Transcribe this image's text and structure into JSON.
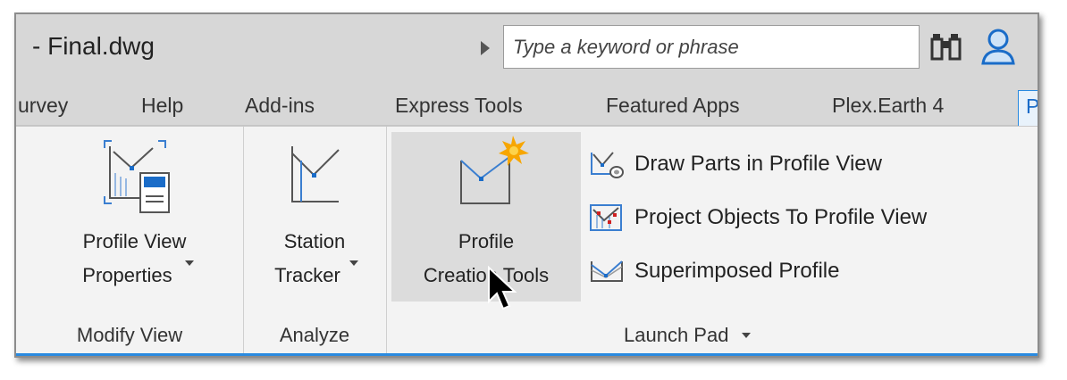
{
  "titlebar": {
    "doc_title": "- Final.dwg",
    "search_placeholder": "Type a keyword or phrase"
  },
  "tabs": [
    {
      "label": "urvey"
    },
    {
      "label": "Help"
    },
    {
      "label": "Add-ins"
    },
    {
      "label": "Express Tools"
    },
    {
      "label": "Featured Apps"
    },
    {
      "label": "Plex.Earth 4"
    },
    {
      "label": "P"
    }
  ],
  "ribbon": {
    "modify_view": {
      "title": "Modify View",
      "button_line1": "Profile View",
      "button_line2": "Properties"
    },
    "analyze": {
      "title": "Analyze",
      "button_line1": "Station",
      "button_line2": "Tracker"
    },
    "launch_pad": {
      "title": "Launch Pad",
      "big_line1": "Profile",
      "big_line2": "Creation Tools",
      "items": [
        {
          "label": "Draw Parts in Profile View"
        },
        {
          "label": "Project Objects To Profile View"
        },
        {
          "label": "Superimposed Profile"
        }
      ]
    }
  },
  "colors": {
    "accent": "#1a6cc8",
    "star": "#f7a600"
  }
}
